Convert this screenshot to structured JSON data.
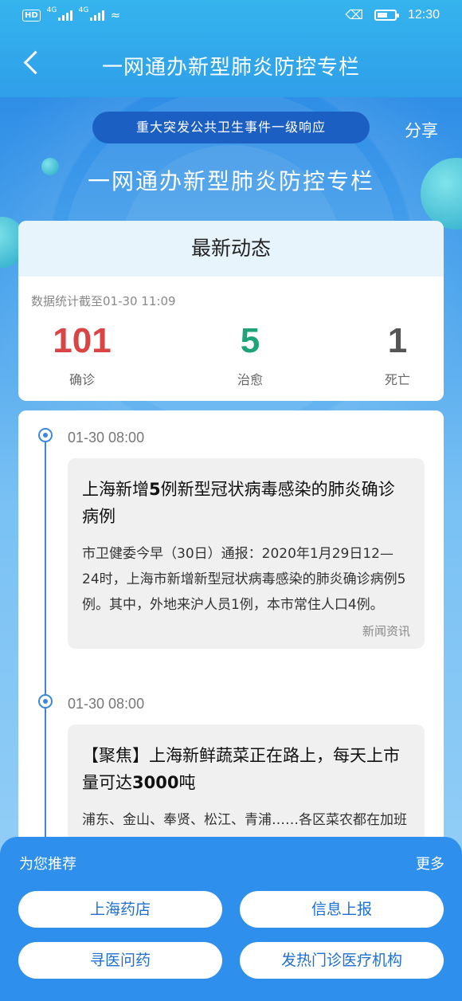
{
  "status_bar": {
    "hd": "HD",
    "sim1": "4G",
    "sim2": "4G",
    "time": "12:30",
    "icons": [
      "hd-icon",
      "signal-icon",
      "signal-icon",
      "wifi-icon",
      "mute-icon",
      "battery-icon"
    ]
  },
  "nav": {
    "title": "一网通办新型肺炎防控专栏",
    "back_icon": "chevron-left-icon"
  },
  "hero": {
    "alert": "重大突发公共卫生事件一级响应",
    "share": "分享",
    "title": "一网通办新型肺炎防控专栏"
  },
  "stats": {
    "header": "最新动态",
    "timestamp": "数据统计截至01-30 11:09",
    "items": [
      {
        "value": "101",
        "label": "确诊",
        "color": "#d94444"
      },
      {
        "value": "5",
        "label": "治愈",
        "color": "#1fa47a"
      },
      {
        "value": "1",
        "label": "死亡",
        "color": "#555555"
      }
    ]
  },
  "timeline": [
    {
      "time": "01-30 08:00",
      "title_pre": "上海新增",
      "title_bold": "5",
      "title_post": "例新型冠状病毒感染的肺炎确诊病例",
      "body": "市卫健委今早（30日）通报：2020年1月29日12—24时，上海市新增新型冠状病毒感染的肺炎确诊病例5例。其中，外地来沪人员1例，本市常住人口4例。",
      "source": "新闻资讯"
    },
    {
      "time": "01-30 08:00",
      "title_pre": "【聚焦】上海新鲜蔬菜正在路上，每天上市量可达",
      "title_bold": "3000",
      "title_post": "吨",
      "body": "浦东、金山、奉贤、松江、青浦……各区菜农都在加班加点抢采收青菜、鸡毛菜、生菜",
      "source": ""
    }
  ],
  "recommend": {
    "title": "为您推荐",
    "more": "更多",
    "buttons": [
      "上海药店",
      "信息上报",
      "寻医问药",
      "发热门诊医疗机构"
    ]
  },
  "colors": {
    "primary": "#2f8fed",
    "accent_dark": "#1c5fc3",
    "confirmed": "#d94444",
    "cured": "#1fa47a"
  }
}
